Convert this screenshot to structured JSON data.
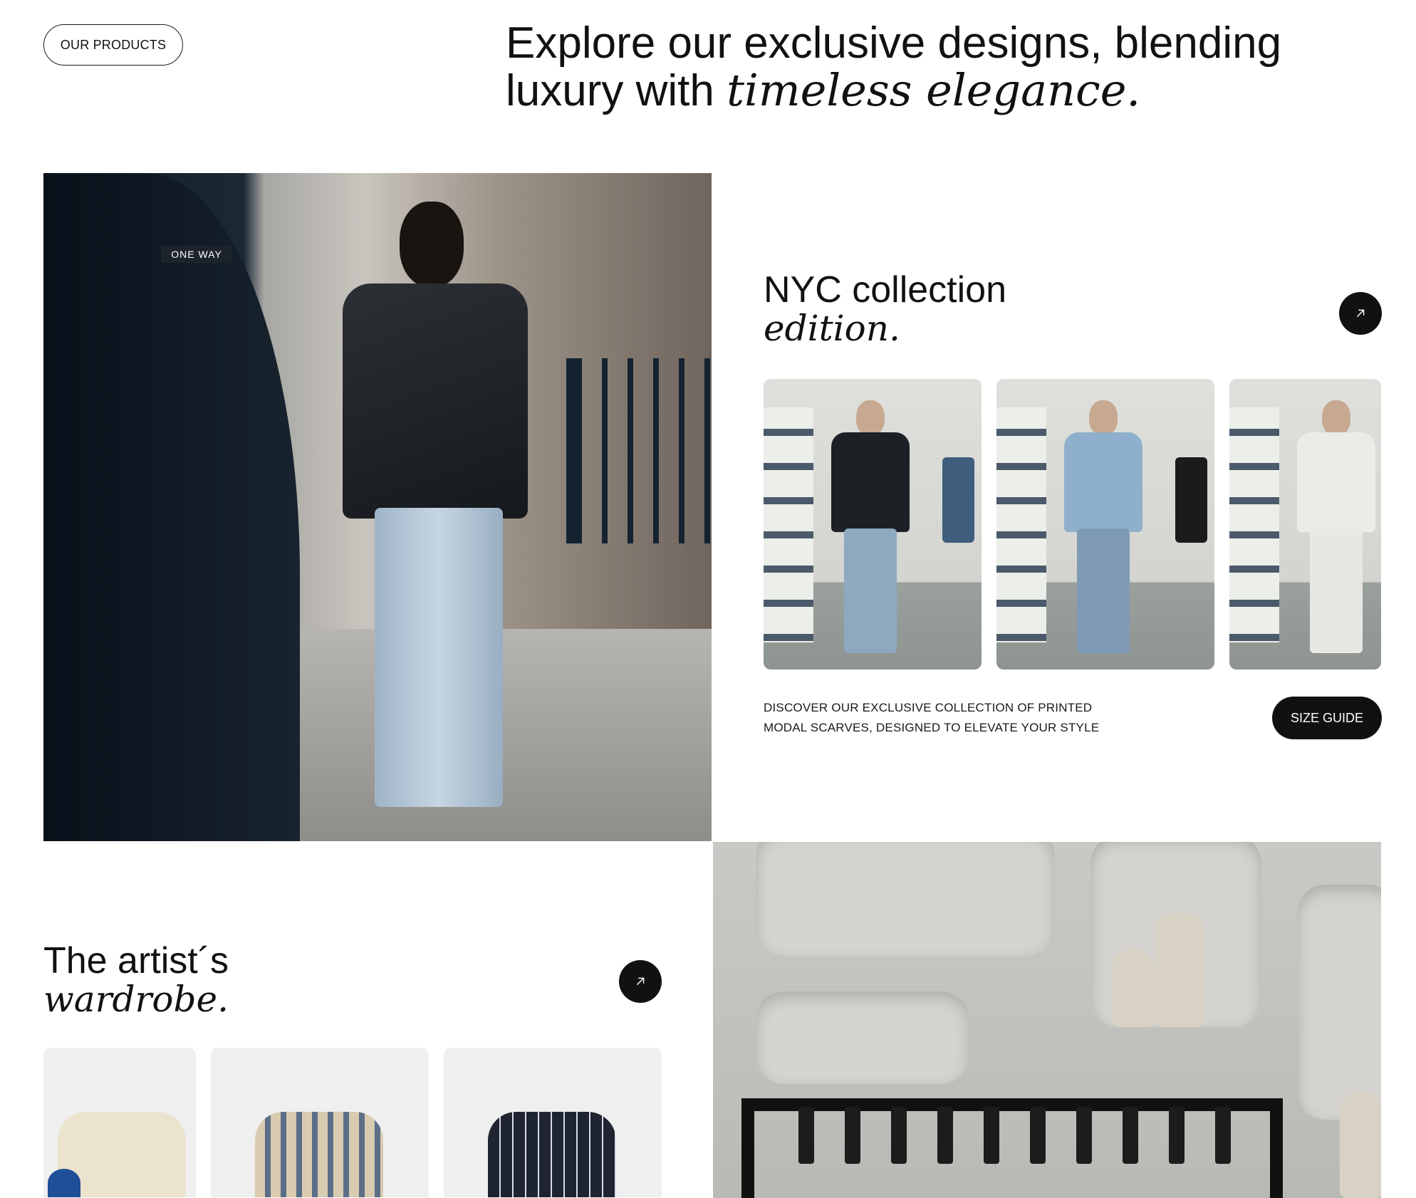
{
  "header": {
    "products_button": "OUR PRODUCTS",
    "headline_plain_1": "Explore our exclusive designs, blending",
    "headline_plain_2": "luxury with ",
    "headline_italic": "timeless elegance."
  },
  "hero": {
    "street_sign": "ONE WAY"
  },
  "collection": {
    "title": "NYC collection",
    "title_italic": "edition.",
    "cards": [
      {
        "top_color": "#1d2126",
        "legs_color": "#8ea8c0"
      },
      {
        "top_color": "#8fb0cc",
        "legs_color": "#7e9ab5"
      },
      {
        "top_color": "#ecece6",
        "legs_color": "#e8e8e2"
      }
    ],
    "description_line1": "DISCOVER OUR EXCLUSIVE COLLECTION OF PRINTED",
    "description_line2": "MODAL SCARVES, DESIGNED TO ELEVATE YOUR STYLE",
    "size_guide": "SIZE GUIDE",
    "arrow_icon": "arrow-up-right-icon"
  },
  "wardrobe": {
    "title": "The artist´s",
    "title_italic": "wardrobe.",
    "arrow_icon": "arrow-up-right-icon",
    "shirts": [
      {
        "color": "#ece3cf"
      },
      {
        "color": "#d9cbb0"
      },
      {
        "color": "#1e2430"
      }
    ]
  },
  "colors": {
    "text": "#111111",
    "button_dark": "#111111",
    "card_background": "#efefef"
  }
}
